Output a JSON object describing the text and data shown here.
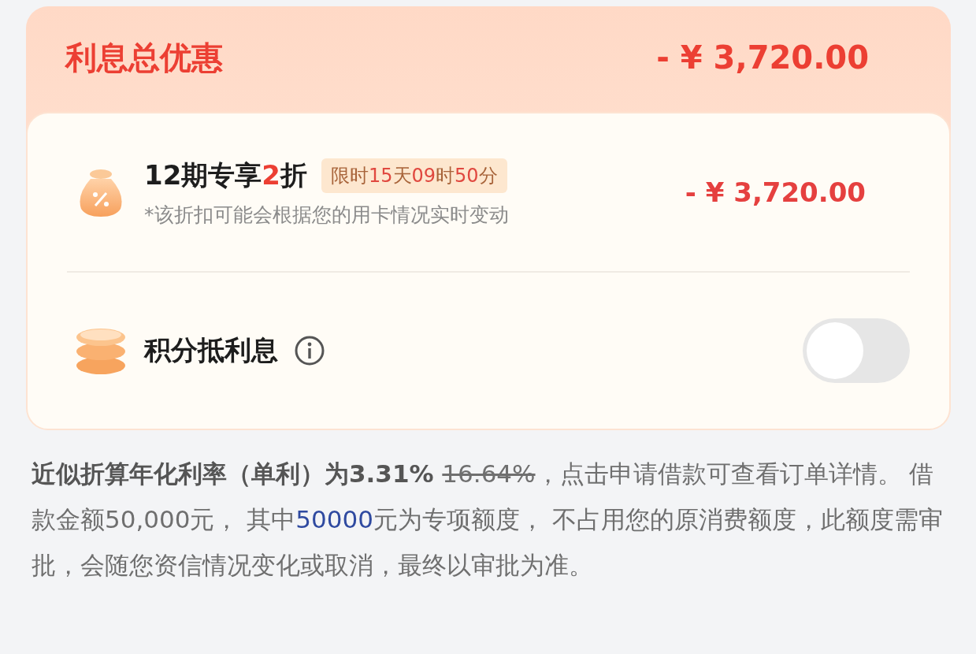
{
  "summary": {
    "title": "利息总优惠",
    "amount": "- ¥ 3,720.00"
  },
  "offers": [
    {
      "kind": "discount",
      "title": [
        {
          "kind": "plain",
          "text": "12期专享"
        },
        {
          "kind": "accent",
          "text": "2"
        },
        {
          "kind": "plain",
          "text": "折"
        }
      ],
      "badge": [
        {
          "kind": "plain",
          "text": "限时"
        },
        {
          "kind": "accent",
          "text": "15"
        },
        {
          "kind": "plain",
          "text": "天"
        },
        {
          "kind": "accent",
          "text": "09"
        },
        {
          "kind": "plain",
          "text": "时"
        },
        {
          "kind": "accent",
          "text": "50"
        },
        {
          "kind": "plain",
          "text": "分"
        }
      ],
      "note": "*该折扣可能会根据您的用卡情况实时变动",
      "amount": "- ¥ 3,720.00"
    },
    {
      "kind": "points",
      "title": [
        {
          "kind": "plain",
          "text": "积分抵利息"
        }
      ],
      "on": false
    }
  ],
  "disclaimer": [
    {
      "kind": "bold",
      "text": "近似折算年化利率（单利）为3.31% "
    },
    {
      "kind": "struck",
      "text": "16.64%"
    },
    {
      "kind": "plain",
      "text": "，点击申请借款可查看订单详情。 借款金额50,000元， 其中"
    },
    {
      "kind": "link",
      "text": "50000"
    },
    {
      "kind": "plain",
      "text": "元为专项额度， 不占用您的原消费额度，此额度需审批，会随您资信情况变化或取消，最终以审批为准。"
    }
  ]
}
